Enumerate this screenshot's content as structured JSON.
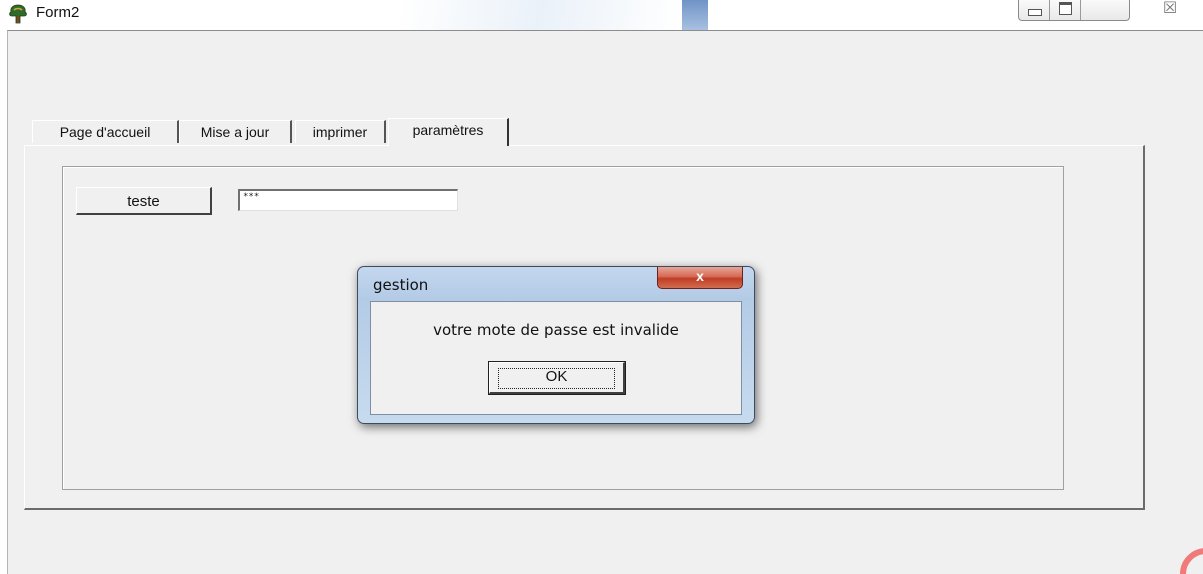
{
  "window": {
    "title": "Form2",
    "app_icon": "tree-icon",
    "controls": {
      "minimize_icon": "minimize-icon",
      "maximize_icon": "maximize-icon",
      "close_glyph": "☒"
    }
  },
  "tabs": [
    {
      "label": "Page d'accueil",
      "active": false
    },
    {
      "label": "Mise a jour",
      "active": false
    },
    {
      "label": "imprimer",
      "active": false
    },
    {
      "label": "paramètres",
      "active": true
    }
  ],
  "panel": {
    "teste_button": "teste",
    "password_value": "***"
  },
  "dialog": {
    "title": "gestion",
    "close_glyph": "x",
    "message": "votre mote de passe est invalide",
    "ok_label": "OK"
  },
  "colors": {
    "form_background": "#f0f0f0",
    "dialog_frame": "#c3d7ee",
    "dialog_close": "#c9503a"
  }
}
